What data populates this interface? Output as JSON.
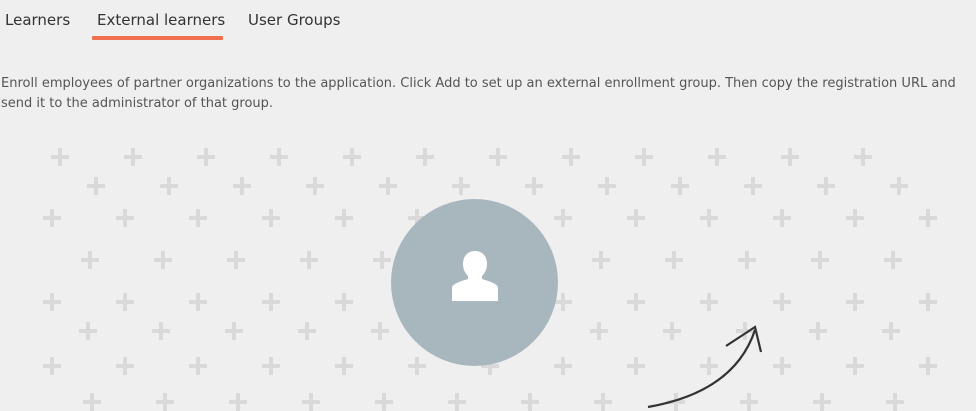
{
  "tabs": [
    {
      "label": "Learners"
    },
    {
      "label": "External learners",
      "active": true
    },
    {
      "label": "User Groups"
    }
  ],
  "accent_color": "#f07050",
  "description": "Enroll employees of partner organizations to the application. Click Add to set up an external enrollment group. Then copy the registration URL and send it to the administrator of that group.",
  "illustration": {
    "avatar_icon": "person-silhouette-icon",
    "background_icon": "plus-pattern",
    "arrow_icon": "curved-arrow-icon",
    "avatar_color": "#a8b7be"
  }
}
